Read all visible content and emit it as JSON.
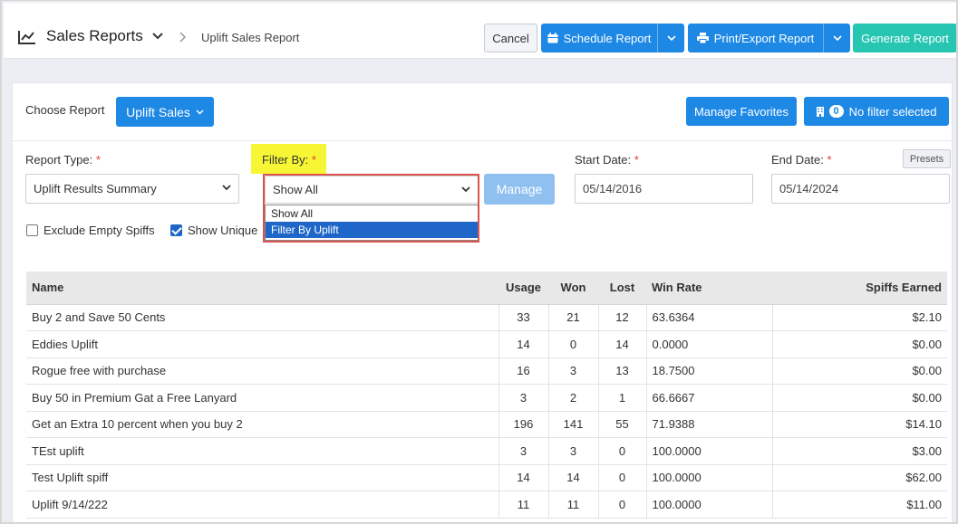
{
  "header": {
    "title": "Sales Reports",
    "breadcrumb": "Uplift Sales Report",
    "cancel_label": "Cancel",
    "schedule_label": "Schedule Report",
    "print_label": "Print/Export Report",
    "generate_label": "Generate Report"
  },
  "toolbar": {
    "choose_report_label": "Choose Report",
    "report_button_label": "Uplift Sales",
    "favorites_label": "Manage Favorites",
    "filter_count": "0",
    "filter_label": "No filter selected"
  },
  "form": {
    "report_type_label": "Report Type:",
    "report_type_value": "Uplift Results Summary",
    "filter_by_label": "Filter By:",
    "filter_by_value": "Show All",
    "filter_options": [
      "Show All",
      "Filter By Uplift"
    ],
    "manage_label": "Manage",
    "start_date_label": "Start Date:",
    "start_date_value": "05/14/2016",
    "end_date_label": "End Date:",
    "end_date_value": "05/14/2024",
    "presets_label": "Presets",
    "required_mark": "*",
    "exclude_empty_label": "Exclude Empty Spiffs",
    "show_unique_label": "Show Unique"
  },
  "table": {
    "headers": [
      "Name",
      "Usage",
      "Won",
      "Lost",
      "Win Rate",
      "Spiffs Earned"
    ],
    "rows": [
      [
        "Buy 2 and Save 50 Cents",
        "33",
        "21",
        "12",
        "63.6364",
        "$2.10"
      ],
      [
        "Eddies Uplift",
        "14",
        "0",
        "14",
        "0.0000",
        "$0.00"
      ],
      [
        "Rogue free with purchase",
        "16",
        "3",
        "13",
        "18.7500",
        "$0.00"
      ],
      [
        "Buy 50 in Premium Gat a Free Lanyard",
        "3",
        "2",
        "1",
        "66.6667",
        "$0.00"
      ],
      [
        "Get an Extra 10 percent when you buy 2",
        "196",
        "141",
        "55",
        "71.9388",
        "$14.10"
      ],
      [
        "TEst uplift",
        "3",
        "3",
        "0",
        "100.0000",
        "$3.00"
      ],
      [
        "Test Uplift spiff",
        "14",
        "14",
        "0",
        "100.0000",
        "$62.00"
      ],
      [
        "Uplift 9/14/222",
        "11",
        "11",
        "0",
        "100.0000",
        "$11.00"
      ]
    ]
  },
  "colors": {
    "primary": "#1e88e5",
    "generate": "#26c6b3",
    "highlight": "#f6f634",
    "callout": "#d9534f"
  }
}
